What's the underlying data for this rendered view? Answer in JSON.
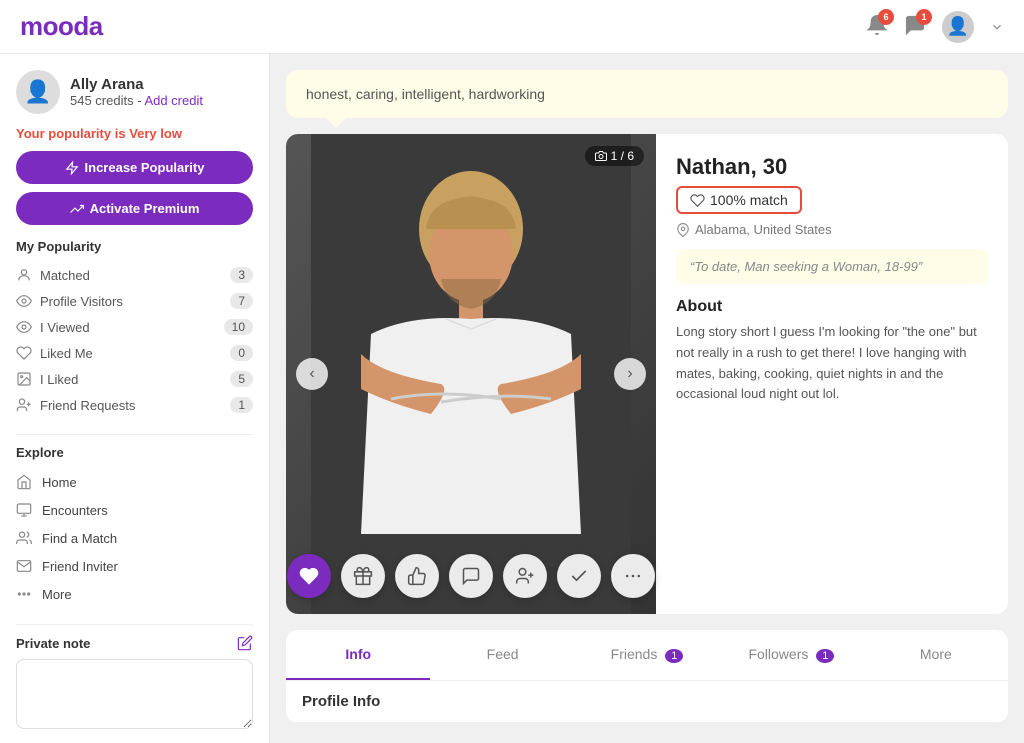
{
  "header": {
    "logo": "mooda",
    "notifications": {
      "bell_badge": "6",
      "message_badge": "1"
    }
  },
  "sidebar": {
    "user": {
      "name": "Ally Arana",
      "credits": "545 credits",
      "add_credit": "Add credit",
      "popularity_label": "Your popularity is",
      "popularity_status": "Very low"
    },
    "buttons": {
      "increase_popularity": "Increase Popularity",
      "activate_premium": "Activate Premium"
    },
    "my_popularity": {
      "title": "My Popularity",
      "items": [
        {
          "label": "Matched",
          "count": "3"
        },
        {
          "label": "Profile Visitors",
          "count": "7"
        },
        {
          "label": "I Viewed",
          "count": "10"
        },
        {
          "label": "Liked Me",
          "count": "0"
        },
        {
          "label": "I Liked",
          "count": "5"
        },
        {
          "label": "Friend Requests",
          "count": "1"
        }
      ]
    },
    "explore": {
      "title": "Explore",
      "items": [
        {
          "label": "Home"
        },
        {
          "label": "Encounters"
        },
        {
          "label": "Find a Match"
        },
        {
          "label": "Friend Inviter"
        },
        {
          "label": "More"
        }
      ]
    },
    "private_note": {
      "title": "Private note",
      "placeholder": ""
    }
  },
  "quote": {
    "text": "honest, caring, intelligent, hardworking"
  },
  "profile": {
    "name": "Nathan",
    "age": "30",
    "match_percent": "100% match",
    "location": "Alabama, United States",
    "seeking": "“To date, Man seeking a Woman, 18-99”",
    "about_title": "About",
    "about_text": "Long story short I guess I'm looking for \"the one\" but not really in a rush to get there! I love hanging with mates, baking, cooking, quiet nights in and the occasional loud night out lol.",
    "photo_counter": "1 / 6"
  },
  "profile_tabs": {
    "tabs": [
      {
        "label": "Info",
        "active": true,
        "badge": ""
      },
      {
        "label": "Feed",
        "active": false,
        "badge": ""
      },
      {
        "label": "Friends",
        "active": false,
        "badge": "1"
      },
      {
        "label": "Followers",
        "active": false,
        "badge": "1"
      },
      {
        "label": "More",
        "active": false,
        "badge": ""
      }
    ],
    "section_title": "Profile Info"
  },
  "icons": {
    "bell": "🔔",
    "message": "💬",
    "heart_action": "♥",
    "gift": "🎁",
    "like": "👍",
    "chat": "💬",
    "add_friend": "👤+",
    "check": "✓",
    "more": "•••"
  }
}
